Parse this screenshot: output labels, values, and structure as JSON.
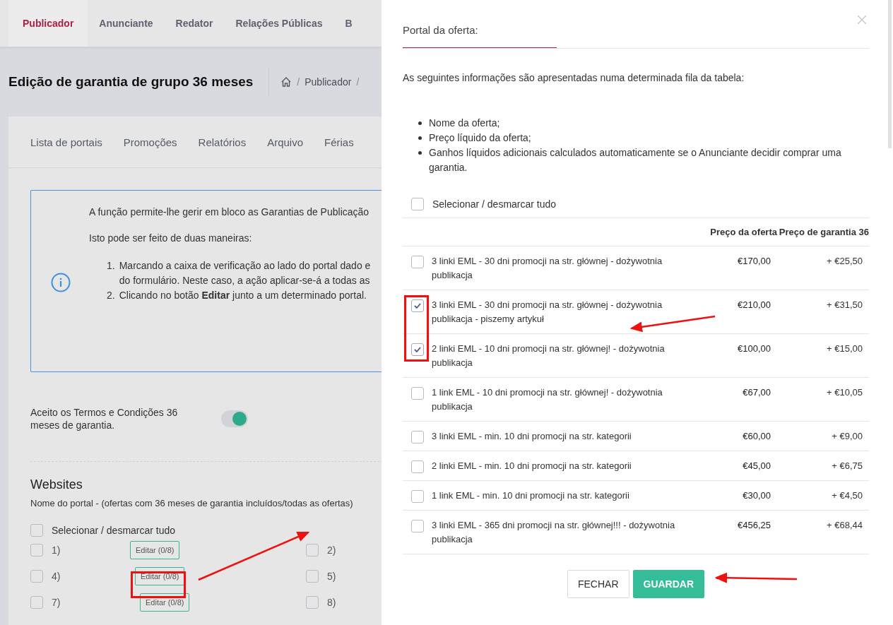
{
  "top_tabs": [
    {
      "label": "Publicador",
      "selected": true
    },
    {
      "label": "Anunciante",
      "selected": false
    },
    {
      "label": "Redator",
      "selected": false
    },
    {
      "label": "Relações Públicas",
      "selected": false
    },
    {
      "label": "B",
      "selected": false
    }
  ],
  "page_title": "Edição de garantia de grupo 36 meses",
  "breadcrumb": [
    {
      "kind": "separator",
      "text": "/"
    },
    {
      "kind": "link",
      "text": "Publicador"
    },
    {
      "kind": "separator",
      "text": "/"
    }
  ],
  "sub_tabs": [
    "Lista de portais",
    "Promoções",
    "Relatórios",
    "Arquivo",
    "Férias"
  ],
  "info_box": {
    "intro": "A função permite-lhe gerir em bloco as Garantias de Publicação",
    "ways_heading": "Isto pode ser feito de duas maneiras:",
    "steps": [
      {
        "number": "1.",
        "lines": [
          "Marcando a caixa de verificação ao lado do portal dado e",
          "do formulário. Neste caso, a ação aplicar-se-á a todas as"
        ]
      },
      {
        "number": "2.",
        "lines": [
          "Clicando no botão **Editar** junto a um determinado portal."
        ]
      }
    ]
  },
  "terms_toggle": {
    "label": "Aceito os Termos e Condições 36 meses de garantia.",
    "on": true
  },
  "websites": {
    "title": "Websites",
    "subtitle": "Nome do portal - (ofertas com 36 meses de garantia incluídos/todas as ofertas)",
    "select_all": {
      "label": "Selecionar / desmarcar tudo",
      "checked": false
    },
    "portals": [
      {
        "number": "1)",
        "checked": false,
        "edit_label": "Editar (0/8)"
      },
      {
        "number": "2)",
        "checked": false
      },
      {
        "number": "4)",
        "checked": false,
        "edit_label": "Editar (0/8)"
      },
      {
        "number": "5)",
        "checked": false
      },
      {
        "number": "7)",
        "checked": false,
        "edit_label": "Editar (0/8)"
      },
      {
        "number": "8)",
        "checked": false
      }
    ]
  },
  "modal": {
    "tab": "Portal da oferta:",
    "intro": "As seguintes informações são apresentadas numa determinada fila da tabela:",
    "bullets": [
      "Nome da oferta;",
      "Preço líquido da oferta;",
      "Ganhos líquidos adicionais calculados automaticamente se o Anunciante decidir comprar uma garantia."
    ],
    "select_all": {
      "label": "Selecionar / desmarcar tudo",
      "checked": false
    },
    "columns": [
      "Preço da oferta",
      "Preço de garantia 36"
    ],
    "offers": [
      {
        "name": "3 linki EML - 30 dni promocji na str. głównej - dożywotnia publikacja",
        "checked": false,
        "price": "€170,00",
        "guarantee": "+ €25,50"
      },
      {
        "name": "3 linki EML - 30 dni promocji na str. głównej - dożywotnia publikacja - piszemy artykuł",
        "checked": true,
        "price": "€210,00",
        "guarantee": "+ €31,50"
      },
      {
        "name": "2 linki EML - 10 dni promocji na str. głównej! - dożywotnia publikacja",
        "checked": true,
        "price": "€100,00",
        "guarantee": "+ €15,00"
      },
      {
        "name": "1 link EML - 10 dni promocji na str. głównej! - dożywotnia publikacja",
        "checked": false,
        "price": "€67,00",
        "guarantee": "+ €10,05"
      },
      {
        "name": "3 linki EML - min. 10 dni promocji na str. kategorii",
        "checked": false,
        "price": "€60,00",
        "guarantee": "+ €9,00"
      },
      {
        "name": "2 linki EML - min. 10 dni promocji na str. kategorii",
        "checked": false,
        "price": "€45,00",
        "guarantee": "+ €6,75"
      },
      {
        "name": "1 link EML - min. 10 dni promocji na str. kategorii",
        "checked": false,
        "price": "€30,00",
        "guarantee": "+ €4,50"
      },
      {
        "name": "3 linki EML - 365 dni promocji na str. głównej!!! - dożywotnia publikacja",
        "checked": false,
        "price": "€456,25",
        "guarantee": "+ €68,44"
      }
    ],
    "buttons": [
      {
        "label": "FECHAR",
        "kind": "secondary"
      },
      {
        "label": "GUARDAR",
        "kind": "primary"
      }
    ]
  }
}
